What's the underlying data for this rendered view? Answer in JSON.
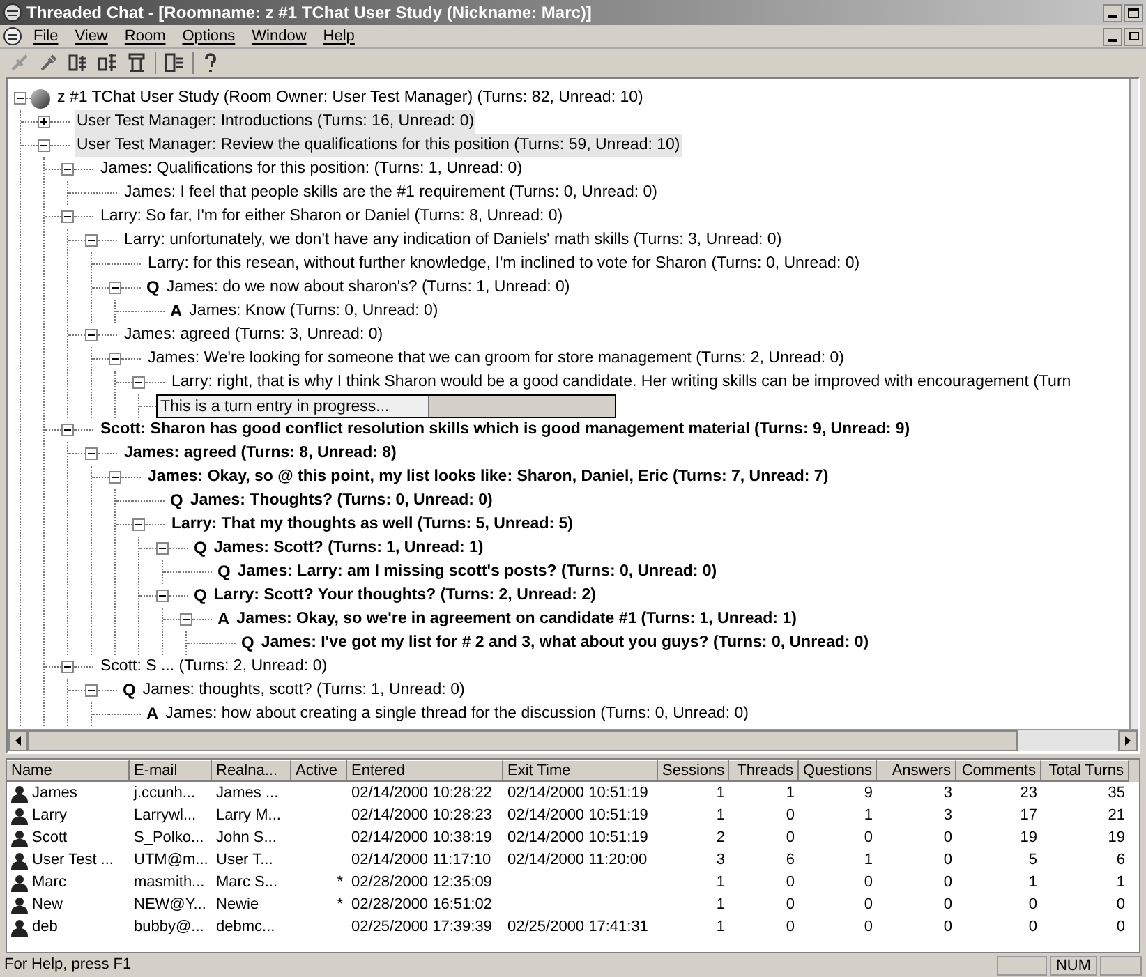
{
  "window": {
    "title": "Threaded Chat - [Roomname: z #1 TChat User Study (Nickname: Marc)]"
  },
  "menu": [
    "File",
    "View",
    "Room",
    "Options",
    "Window",
    "Help"
  ],
  "tree": {
    "text": "z #1 TChat User Study (Room Owner: User Test Manager) (Turns: 82, Unread: 10)",
    "expanded": true,
    "children": [
      {
        "text": "User Test Manager: Introductions (Turns: 16, Unread: 0)",
        "expanded": false,
        "highlighted": true
      },
      {
        "text": "User Test Manager: Review the qualifications for this position (Turns: 59, Unread: 10)",
        "expanded": true,
        "highlighted": true,
        "children": [
          {
            "text": "James: Qualifications for this position: (Turns: 1, Unread: 0)",
            "expanded": true,
            "children": [
              {
                "text": "James: I feel that people skills are the #1 requirement (Turns: 0, Unread: 0)"
              }
            ]
          },
          {
            "text": "Larry: So far, I'm for either Sharon or Daniel (Turns: 8, Unread: 0)",
            "expanded": true,
            "children": [
              {
                "text": "Larry: unfortunately, we don't have any indication of Daniels' math skills (Turns: 3, Unread: 0)",
                "expanded": true,
                "children": [
                  {
                    "text": "Larry: for this resean, without further knowledge, I'm inclined to vote for Sharon (Turns: 0, Unread: 0)"
                  },
                  {
                    "marker": "Q",
                    "text": "James: do we now about sharon's? (Turns: 1, Unread: 0)",
                    "expanded": true,
                    "children": [
                      {
                        "marker": "A",
                        "text": "James: Know (Turns: 0, Unread: 0)"
                      }
                    ]
                  }
                ]
              },
              {
                "text": "James: agreed (Turns: 3, Unread: 0)",
                "expanded": true,
                "children": [
                  {
                    "text": "James: We're looking for someone that we can groom for store management (Turns: 2, Unread: 0)",
                    "expanded": true,
                    "children": [
                      {
                        "text": "Larry: right, that is why I think Sharon would be a good candidate.  Her writing skills can be improved with encouragement (Turn",
                        "expanded": true,
                        "children": [
                          {
                            "kind": "entry",
                            "value": "This is a turn entry in progress..."
                          }
                        ]
                      }
                    ]
                  }
                ]
              }
            ]
          },
          {
            "bold": true,
            "text": "Scott: Sharon has good conflict resolution skills which is good management material (Turns: 9, Unread: 9)",
            "expanded": true,
            "children": [
              {
                "bold": true,
                "text": "James: agreed (Turns: 8, Unread: 8)",
                "expanded": true,
                "children": [
                  {
                    "bold": true,
                    "text": "James: Okay, so @ this point, my list looks like: Sharon, Daniel, Eric (Turns: 7, Unread: 7)",
                    "expanded": true,
                    "children": [
                      {
                        "marker": "Q",
                        "bold": true,
                        "text": "James: Thoughts? (Turns: 0, Unread: 0)"
                      },
                      {
                        "bold": true,
                        "text": "Larry: That my thoughts as well (Turns: 5, Unread: 5)",
                        "expanded": true,
                        "children": [
                          {
                            "marker": "Q",
                            "bold": true,
                            "text": "James: Scott? (Turns: 1, Unread: 1)",
                            "expanded": true,
                            "children": [
                              {
                                "marker": "Q",
                                "bold": true,
                                "text": "James: Larry: am I missing scott's posts? (Turns: 0, Unread: 0)"
                              }
                            ]
                          },
                          {
                            "marker": "Q",
                            "bold": true,
                            "text": "Larry: Scott? Your thoughts? (Turns: 2, Unread: 2)",
                            "expanded": true,
                            "children": [
                              {
                                "marker": "A",
                                "bold": true,
                                "text": "James: Okay, so we're in agreement on candidate #1 (Turns: 1, Unread: 1)",
                                "expanded": true,
                                "children": [
                                  {
                                    "marker": "Q",
                                    "bold": true,
                                    "text": "James: I've got my list for # 2 and 3, what about you guys? (Turns: 0, Unread: 0)"
                                  }
                                ]
                              }
                            ]
                          }
                        ]
                      }
                    ]
                  }
                ]
              }
            ]
          },
          {
            "text": "Scott: S ...  (Turns: 2, Unread: 0)",
            "expanded": true,
            "children": [
              {
                "marker": "Q",
                "text": "James: thoughts, scott? (Turns: 1, Unread: 0)",
                "expanded": true,
                "children": [
                  {
                    "marker": "A",
                    "text": "James: how about creating a single thread for the discussion (Turns: 0, Unread: 0)"
                  }
                ]
              }
            ]
          }
        ]
      }
    ]
  },
  "users": {
    "columns": [
      "Name",
      "E-mail",
      "Realna...",
      "Active",
      "Entered",
      "Exit Time",
      "Sessions",
      "Threads",
      "Questions",
      "Answers",
      "Comments",
      "Total Turns"
    ],
    "rows": [
      {
        "name": "James",
        "email": "j.ccunh...",
        "realname": "James ...",
        "entered": "02/14/2000 10:28:22",
        "exit_time": "02/14/2000 10:51:19",
        "sessions": "1",
        "threads": "1",
        "questions": "9",
        "answers": "3",
        "comments": "23",
        "total_turns": "35"
      },
      {
        "name": "Larry",
        "email": "Larrywl...",
        "realname": "Larry M...",
        "entered": "02/14/2000 10:28:23",
        "exit_time": "02/14/2000 10:51:19",
        "sessions": "1",
        "threads": "0",
        "questions": "1",
        "answers": "3",
        "comments": "17",
        "total_turns": "21"
      },
      {
        "name": "Scott",
        "email": "S_Polko...",
        "realname": "John S...",
        "entered": "02/14/2000 10:38:19",
        "exit_time": "02/14/2000 10:51:19",
        "sessions": "2",
        "threads": "0",
        "questions": "0",
        "answers": "0",
        "comments": "19",
        "total_turns": "19"
      },
      {
        "name": "User Test ...",
        "email": "UTM@m...",
        "realname": "User T...",
        "entered": "02/14/2000 11:17:10",
        "exit_time": "02/14/2000 11:20:00",
        "sessions": "3",
        "threads": "6",
        "questions": "1",
        "answers": "0",
        "comments": "5",
        "total_turns": "6"
      },
      {
        "name": "Marc",
        "email": "masmith...",
        "realname": "Marc S...",
        "active": "*",
        "entered": "02/28/2000 12:35:09",
        "sessions": "1",
        "threads": "0",
        "questions": "0",
        "answers": "0",
        "comments": "1",
        "total_turns": "1"
      },
      {
        "name": "New",
        "email": "NEW@Y...",
        "realname": "Newie",
        "active": "*",
        "entered": "02/28/2000 16:51:02",
        "sessions": "1",
        "threads": "0",
        "questions": "0",
        "answers": "0",
        "comments": "0",
        "total_turns": "0"
      },
      {
        "name": "deb",
        "email": "bubby@...",
        "realname": "debmc...",
        "entered": "02/25/2000 17:39:39",
        "exit_time": "02/25/2000 17:41:31",
        "sessions": "1",
        "threads": "0",
        "questions": "0",
        "answers": "0",
        "comments": "0",
        "total_turns": "0"
      }
    ]
  },
  "status_bar": {
    "text": "For Help, press F1",
    "indicator": "NUM"
  }
}
